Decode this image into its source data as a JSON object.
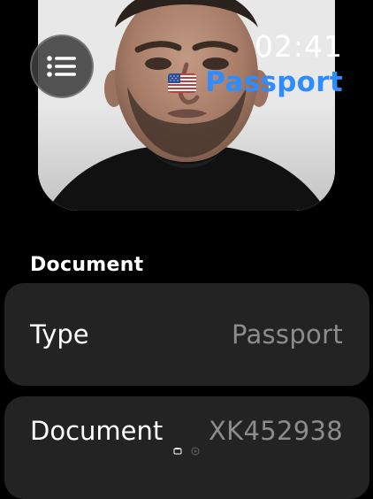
{
  "header": {
    "time": "02:41",
    "document_title": "Passport",
    "flag_icon": "us-flag-icon",
    "menu_icon": "list-icon"
  },
  "section": {
    "title": "Document"
  },
  "details": [
    {
      "label": "Type",
      "value": "Passport"
    },
    {
      "label": "Document",
      "value": "XK452938"
    }
  ],
  "colors": {
    "accent": "#2f8cff",
    "row_background": "#232323",
    "secondary_text": "#8c8c8c"
  }
}
